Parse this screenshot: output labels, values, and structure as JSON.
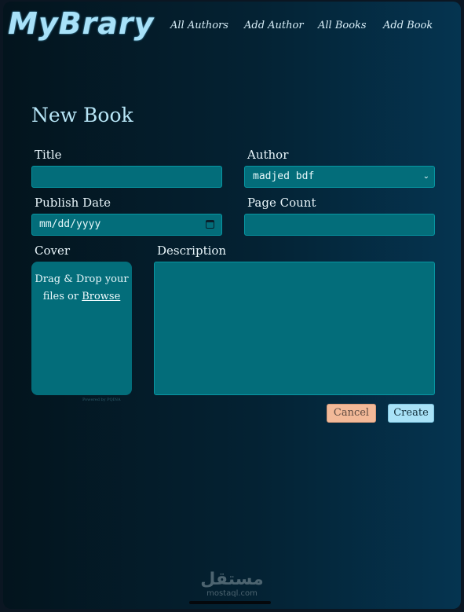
{
  "app": {
    "logo": "MyBrary"
  },
  "nav": {
    "items": [
      {
        "label": "All Authors"
      },
      {
        "label": "Add Author"
      },
      {
        "label": "All Books"
      },
      {
        "label": "Add Book"
      }
    ]
  },
  "page": {
    "title": "New Book"
  },
  "form": {
    "title": {
      "label": "Title",
      "value": ""
    },
    "author": {
      "label": "Author",
      "selected": "madjed bdf"
    },
    "publish_date": {
      "label": "Publish Date",
      "placeholder": "mm/dd/yyyy"
    },
    "page_count": {
      "label": "Page Count",
      "value": ""
    },
    "cover": {
      "label": "Cover",
      "drop_text": "Drag & Drop your",
      "drop_text_2": "files or",
      "browse": "Browse",
      "powered_by": "Powered by PQINA"
    },
    "description": {
      "label": "Description",
      "value": ""
    }
  },
  "actions": {
    "cancel": "Cancel",
    "create": "Create"
  },
  "watermark": {
    "arabic": "مستقل",
    "latin": "mostaql.com"
  },
  "colors": {
    "accent": "#036d7a",
    "logo": "#a8e1f8",
    "cancel": "#f2b998",
    "create": "#a9e2f7"
  },
  "icons": {
    "author_select": "chevron-down-icon",
    "publish_date": "calendar-icon"
  }
}
